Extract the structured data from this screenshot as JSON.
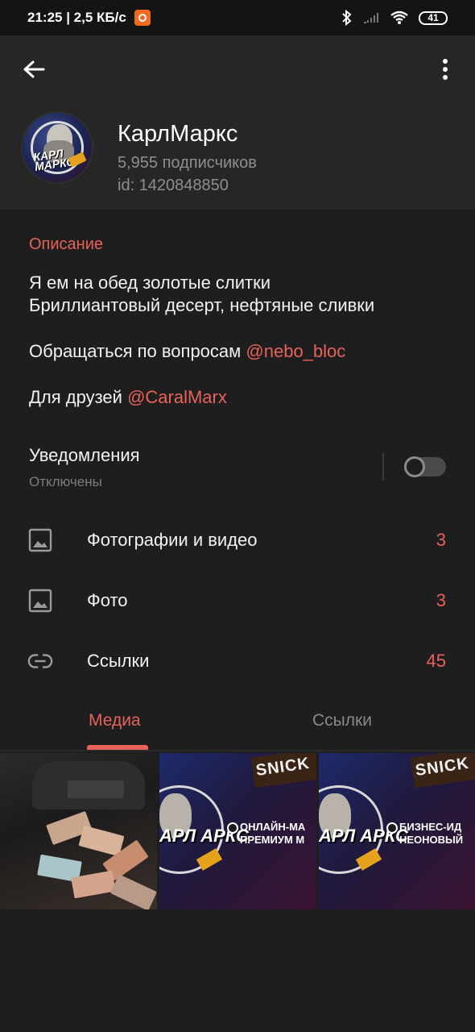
{
  "status_bar": {
    "time_speed": "21:25 | 2,5 КБ/с",
    "battery": "41"
  },
  "header": {
    "channel_name": "КарлМаркс",
    "subscribers": "5,955 подписчиков",
    "channel_id": "id: 1420848850",
    "avatar_text": "КАРЛ МАРКС"
  },
  "description": {
    "title": "Описание",
    "line1": "Я ем на обед золотые слитки",
    "line2": "Бриллиантовый десерт, нефтяные сливки",
    "contact_prefix": "Обращаться по вопросам ",
    "contact_mention": "@nebo_bloc",
    "friends_prefix": "Для друзей ",
    "friends_mention": "@CaralMarx"
  },
  "notifications": {
    "title": "Уведомления",
    "status": "Отключены",
    "enabled": false
  },
  "media_rows": [
    {
      "label": "Фотографии и видео",
      "count": "3",
      "icon": "image-icon"
    },
    {
      "label": "Фото",
      "count": "3",
      "icon": "image-icon"
    },
    {
      "label": "Ссылки",
      "count": "45",
      "icon": "link-icon"
    }
  ],
  "tabs": [
    {
      "label": "Медиа",
      "active": true
    },
    {
      "label": "Ссылки",
      "active": false
    }
  ],
  "thumbnails": [
    {
      "kind": "photo"
    },
    {
      "kind": "promo",
      "brand": "АРЛ АРКС",
      "text_line1": "ОНЛАЙН-МА",
      "text_line2": "ПРЕМИУМ М",
      "bar": "SNICK"
    },
    {
      "kind": "promo",
      "brand": "АРЛ АРКС",
      "text_line1": "БИЗНЕС-ИД",
      "text_line2": "НЕОНОВЫЙ",
      "bar": "SNICK"
    }
  ],
  "colors": {
    "accent": "#e8625a",
    "background": "#1e1e1e",
    "header_bg": "#262626"
  }
}
